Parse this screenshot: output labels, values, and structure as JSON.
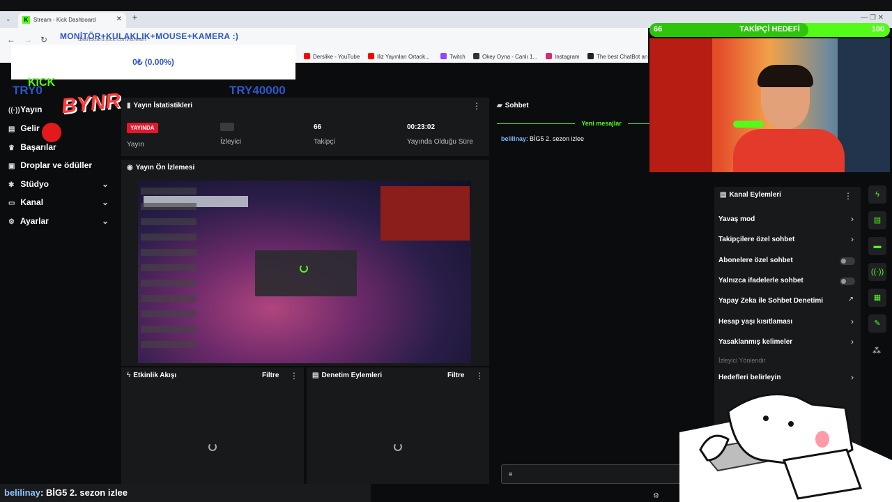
{
  "browser": {
    "tab_title": "Stream - Kick Dashboard",
    "tab_favicon": "K",
    "new_tab": "+",
    "url": "dashboard.kick.com/stream",
    "window_controls": "—   ❐   ✕",
    "bookmarks": [
      {
        "label": "Derslike - YouTube",
        "color": "#ff0000"
      },
      {
        "label": "Iliz Yayınları Ortaok...",
        "color": "#ff0000"
      },
      {
        "label": "Twitch",
        "color": "#9146ff"
      },
      {
        "label": "Okey Oyna - Canlı 1...",
        "color": "#333333"
      },
      {
        "label": "Instagram",
        "color": "#d62976"
      },
      {
        "label": "The best ChatBot an...",
        "color": "#222222"
      }
    ]
  },
  "overlay": {
    "banner_text": "MONİTÖR+KULAKLIK+MOUSE+KAMERA :)",
    "progress_text": "0₺ (0.00%)",
    "current": "TRY0",
    "goal": "TRY40000",
    "logo": "KICK",
    "sticker": "BYNR"
  },
  "sidebar": {
    "items": [
      {
        "label": "Yayın",
        "icon": "broadcast-icon"
      },
      {
        "label": "Gelir",
        "icon": "revenue-icon"
      },
      {
        "label": "Başarılar",
        "icon": "trophy-icon"
      },
      {
        "label": "Droplar ve ödüller",
        "icon": "gift-icon"
      },
      {
        "label": "Stüdyo",
        "icon": "palette-icon"
      },
      {
        "label": "Kanal",
        "icon": "tv-icon"
      },
      {
        "label": "Ayarlar",
        "icon": "gear-icon"
      }
    ]
  },
  "stats": {
    "title": "Yayın İstatistikleri",
    "live_badge": "YAYINDA",
    "cols": [
      {
        "value": "",
        "label": "Yayın"
      },
      {
        "value": "",
        "label": "İzleyici"
      },
      {
        "value": "66",
        "label": "Takipçi"
      },
      {
        "value": "00:23:02",
        "label": "Yayında Olduğu Süre"
      }
    ]
  },
  "preview": {
    "title": "Yayın Ön İzlemesi"
  },
  "activity": {
    "title": "Etkinlik Akışı",
    "filter": "Filtre"
  },
  "moderation": {
    "title": "Denetim Eylemleri",
    "filter": "Filtre"
  },
  "chat": {
    "title": "Sohbet",
    "new_messages": "Yeni mesajlar",
    "messages": [
      {
        "user": "belilinay",
        "text": ": BİG5 2. sezon izlee"
      }
    ]
  },
  "channel_actions": {
    "title": "Kanal Eylemleri",
    "items": [
      {
        "label": "Yavaş mod",
        "control": "chevron"
      },
      {
        "label": "Takipçilere özel sohbet",
        "control": "chevron"
      },
      {
        "label": "Abonelere özel sohbet",
        "control": "toggle"
      },
      {
        "label": "Yalnızca ifadelerle sohbet",
        "control": "toggle"
      },
      {
        "label": "Yapay Zeka ile Sohbet Denetimi",
        "control": "external"
      },
      {
        "label": "Hesap yaşı kısıtlaması",
        "control": "chevron"
      },
      {
        "label": "Yasaklanmış kelimeler",
        "control": "chevron"
      }
    ],
    "section_label": "İzleyici Yönlendir",
    "goals_item": "Hedefleri belirleyin"
  },
  "follower_goal": {
    "current": "66",
    "title": "TAKİPÇİ HEDEFİ",
    "target": "100",
    "progress": 0.66
  },
  "ticker": {
    "user": "belilinay",
    "text": ": BİG5 2. sezon izlee"
  },
  "colors": {
    "accent": "#53fc18",
    "live": "#e3162b",
    "overlay_text": "#2e57c6"
  }
}
